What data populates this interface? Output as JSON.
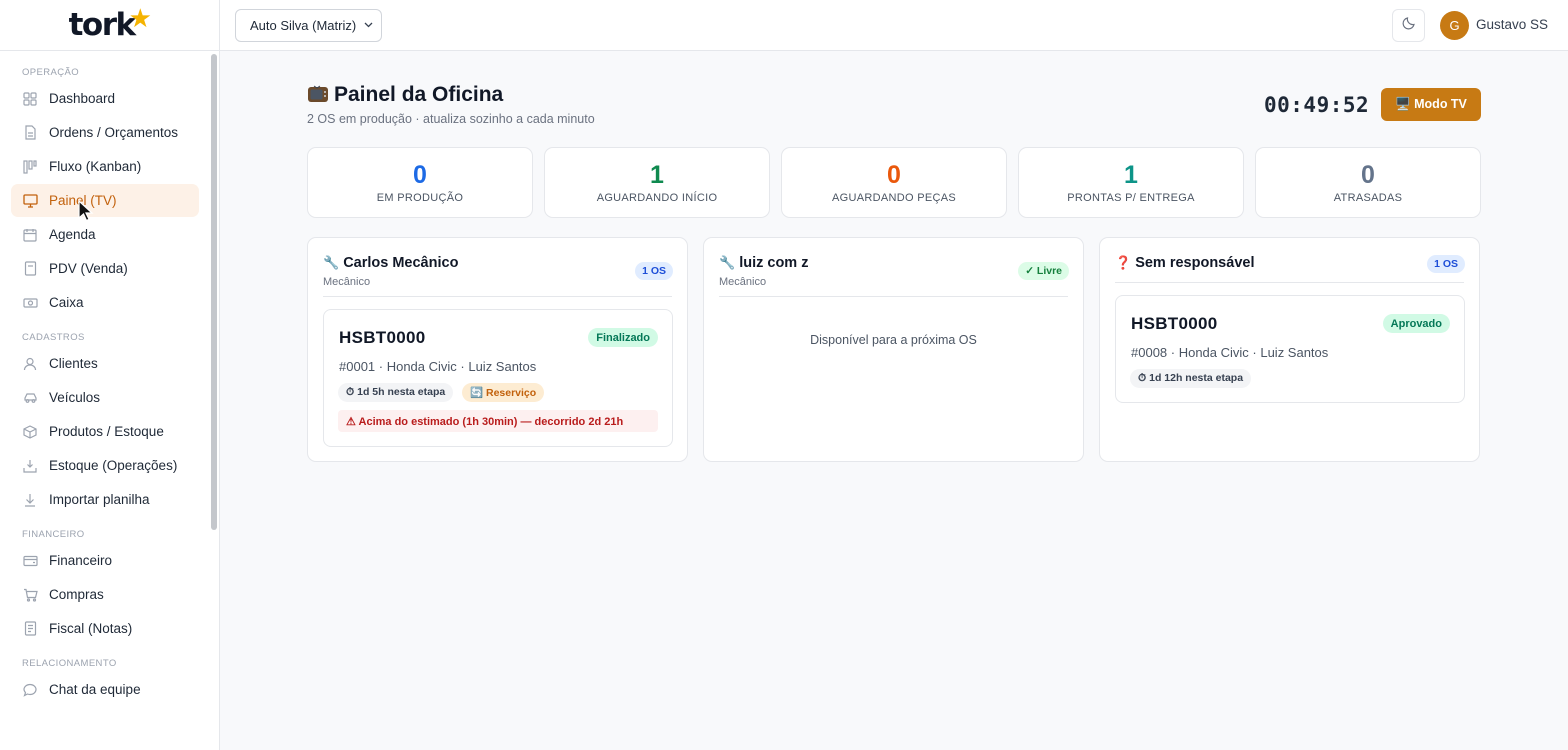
{
  "logo": {
    "text": "tork",
    "mark": "★"
  },
  "sidebar": {
    "sections": [
      {
        "title": "OPERAÇÃO",
        "items": [
          {
            "label": "Dashboard",
            "icon": "grid-icon"
          },
          {
            "label": "Ordens / Orçamentos",
            "icon": "document-icon"
          },
          {
            "label": "Fluxo (Kanban)",
            "icon": "kanban-icon"
          },
          {
            "label": "Painel (TV)",
            "icon": "monitor-icon",
            "active": true
          },
          {
            "label": "Agenda",
            "icon": "calendar-icon"
          },
          {
            "label": "PDV (Venda)",
            "icon": "receipt-icon"
          },
          {
            "label": "Caixa",
            "icon": "cash-icon"
          }
        ]
      },
      {
        "title": "CADASTROS",
        "items": [
          {
            "label": "Clientes",
            "icon": "user-icon"
          },
          {
            "label": "Veículos",
            "icon": "car-icon"
          },
          {
            "label": "Produtos / Estoque",
            "icon": "box-icon"
          },
          {
            "label": "Estoque (Operações)",
            "icon": "inbox-download-icon"
          },
          {
            "label": "Importar planilha",
            "icon": "download-icon"
          }
        ]
      },
      {
        "title": "FINANCEIRO",
        "items": [
          {
            "label": "Financeiro",
            "icon": "wallet-icon"
          },
          {
            "label": "Compras",
            "icon": "cart-icon"
          },
          {
            "label": "Fiscal (Notas)",
            "icon": "invoice-icon"
          }
        ]
      },
      {
        "title": "RELACIONAMENTO",
        "items": [
          {
            "label": "Chat da equipe",
            "icon": "chat-icon"
          }
        ]
      }
    ]
  },
  "topbar": {
    "store": "Auto Silva (Matriz)",
    "user_initial": "G",
    "user_name": "Gustavo SS"
  },
  "header": {
    "title": "Painel da Oficina",
    "subtitle": "2 OS em produção · atualiza sozinho a cada minuto",
    "clock": "00:49:52",
    "tv_button": "🖥️ Modo TV"
  },
  "stats": [
    {
      "value": "0",
      "label": "EM PRODUÇÃO",
      "color": "#1d6ae5"
    },
    {
      "value": "1",
      "label": "AGUARDANDO INÍCIO",
      "color": "#0f8a4f"
    },
    {
      "value": "0",
      "label": "AGUARDANDO PEÇAS",
      "color": "#ea580c"
    },
    {
      "value": "1",
      "label": "PRONTAS P/ ENTREGA",
      "color": "#0d9488"
    },
    {
      "value": "0",
      "label": "ATRASADAS",
      "color": "#64748b"
    }
  ],
  "columns": [
    {
      "icon": "🔧",
      "name": "Carlos Mecânico",
      "role": "Mecânico",
      "badge": "1 OS",
      "card": {
        "plate": "HSBT0000",
        "status": "Finalizado",
        "info": "#0001 · Honda Civic · Luiz Santos",
        "chips": [
          "⏱ 1d 5h nesta etapa",
          "🔄 Reserviço"
        ],
        "warning": "⚠ Acima do estimado (1h 30min) — decorrido 2d 21h"
      }
    },
    {
      "icon": "🔧",
      "name": "luiz com z",
      "role": "Mecânico",
      "badge": "✓ Livre",
      "empty_text": "Disponível para a próxima OS"
    },
    {
      "icon": "❓",
      "name": "Sem responsável",
      "badge": "1 OS",
      "card": {
        "plate": "HSBT0000",
        "status": "Aprovado",
        "info": "#0008 · Honda Civic · Luiz Santos",
        "chips": [
          "⏱ 1d 12h nesta etapa"
        ]
      }
    }
  ]
}
